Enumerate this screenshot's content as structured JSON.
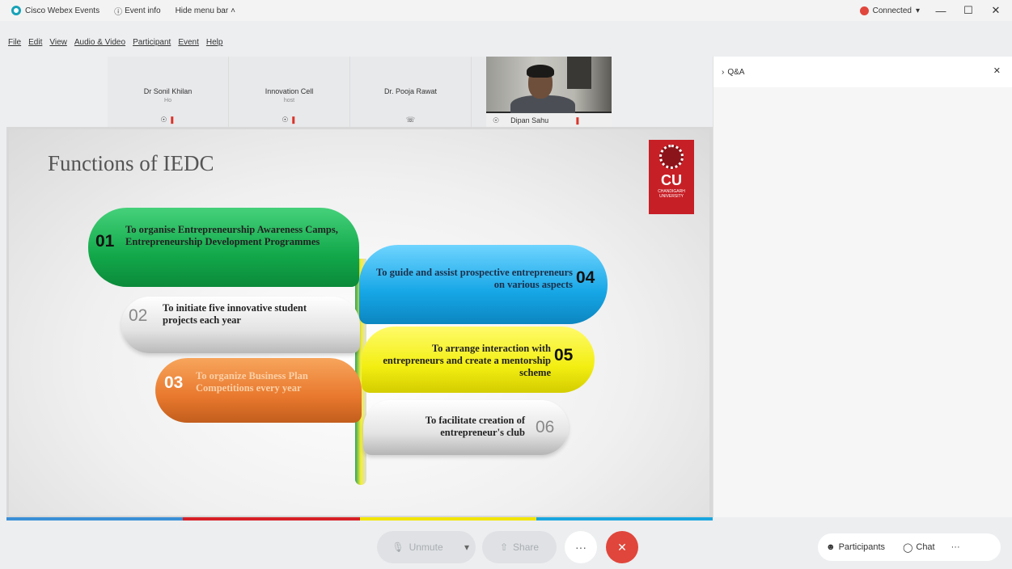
{
  "titlebar": {
    "app_name": "Cisco Webex Events",
    "event_info": "Event info",
    "hide_menu": "Hide menu bar",
    "connected": "Connected",
    "minimize": "—",
    "maximize": "☐",
    "close": "✕"
  },
  "menu": [
    "File",
    "Edit",
    "View",
    "Audio & Video",
    "Participant",
    "Event",
    "Help"
  ],
  "participants": [
    {
      "name": "Dr Sonil Khilan",
      "role": "Ho"
    },
    {
      "name": "Innovation Cell",
      "role": "host"
    },
    {
      "name": "Dr. Pooja Rawat",
      "role": ""
    }
  ],
  "video": {
    "name": "Dipan Sahu"
  },
  "qa": {
    "title": "Q&A"
  },
  "slide": {
    "title": "Functions of IEDC",
    "logo_text": "CU",
    "logo_subtext": "CHANDIGARH UNIVERSITY",
    "items": [
      {
        "num": "01",
        "text": "To organise Entrepreneurship Awareness Camps, Entrepreneurship Development Programmes",
        "color": "#12a84a"
      },
      {
        "num": "02",
        "text": "To initiate five innovative student projects each year",
        "color": "#e3e3e3"
      },
      {
        "num": "03",
        "text": "To organize Business Plan Competitions every year",
        "color": "#e8782d"
      },
      {
        "num": "04",
        "text": "To guide and assist prospective entrepreneurs on various aspects",
        "color": "#16a6e6"
      },
      {
        "num": "05",
        "text": "To arrange interaction with entrepreneurs and create a mentorship scheme",
        "color": "#f3ee12"
      },
      {
        "num": "06",
        "text": "To facilitate creation of entrepreneur's club",
        "color": "#e4e4e4"
      }
    ]
  },
  "colorbar": [
    "#3a8fd6",
    "#d71f26",
    "#f2e500",
    "#1aa6e0"
  ],
  "controls": {
    "unmute": "Unmute",
    "share": "Share",
    "more": "···",
    "leave": "✕"
  },
  "bottom_right": {
    "participants": "Participants",
    "chat": "Chat",
    "more": "···"
  }
}
